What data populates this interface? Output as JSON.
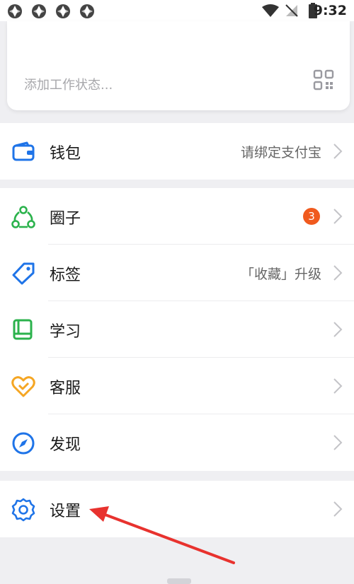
{
  "status_bar": {
    "time": "9:32",
    "icons": [
      "app-notification-icon",
      "app-notification-icon",
      "app-notification-icon",
      "app-notification-icon",
      "wifi-icon",
      "no-signal-icon",
      "battery-icon"
    ]
  },
  "profile": {
    "work_status_placeholder": "添加工作状态..."
  },
  "menu": {
    "wallet": {
      "label": "钱包",
      "value": "请绑定支付宝"
    },
    "circle": {
      "label": "圈子",
      "badge": "3"
    },
    "tags": {
      "label": "标签",
      "value": "「收藏」升级"
    },
    "study": {
      "label": "学习"
    },
    "service": {
      "label": "客服"
    },
    "discover": {
      "label": "发现"
    },
    "settings": {
      "label": "设置"
    }
  },
  "colors": {
    "wallet": "#1f74e8",
    "circle": "#2bb24c",
    "tags": "#1f74e8",
    "study": "#2bb24c",
    "service": "#f5a623",
    "discover": "#1f74e8",
    "settings": "#1f74e8",
    "badge": "#f05a1e",
    "arrow": "#e8322e"
  }
}
